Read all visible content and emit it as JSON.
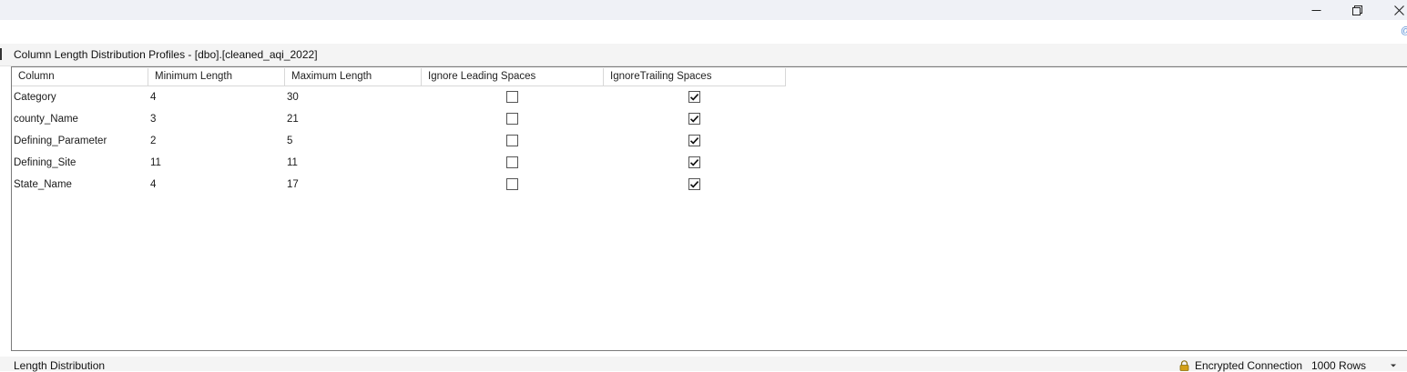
{
  "window": {
    "controls": {
      "minimize_icon": "minimize-icon",
      "restore_icon": "restore-icon",
      "close_icon": "close-icon"
    },
    "help_glyph": "@"
  },
  "panel": {
    "title": "Column Length Distribution Profiles  -  [dbo].[cleaned_aqi_2022]"
  },
  "grid": {
    "columns": [
      "Column",
      "Minimum Length",
      "Maximum Length",
      "Ignore Leading Spaces",
      "IgnoreTrailing Spaces"
    ],
    "rows": [
      {
        "column": "Category",
        "min": "4",
        "max": "30",
        "ignore_leading": false,
        "ignore_trailing": true
      },
      {
        "column": "county_Name",
        "min": "3",
        "max": "21",
        "ignore_leading": false,
        "ignore_trailing": true
      },
      {
        "column": "Defining_Parameter",
        "min": "2",
        "max": "5",
        "ignore_leading": false,
        "ignore_trailing": true
      },
      {
        "column": "Defining_Site",
        "min": "11",
        "max": "11",
        "ignore_leading": false,
        "ignore_trailing": true
      },
      {
        "column": "State_Name",
        "min": "4",
        "max": "17",
        "ignore_leading": false,
        "ignore_trailing": true
      }
    ]
  },
  "status": {
    "left_label": "Length Distribution",
    "connection": "Encrypted Connection",
    "rows": "1000 Rows"
  },
  "colors": {
    "titlebar_bg": "#eff1f6",
    "grid_border": "#7a7a7a",
    "lock_icon": "#d4a017"
  }
}
